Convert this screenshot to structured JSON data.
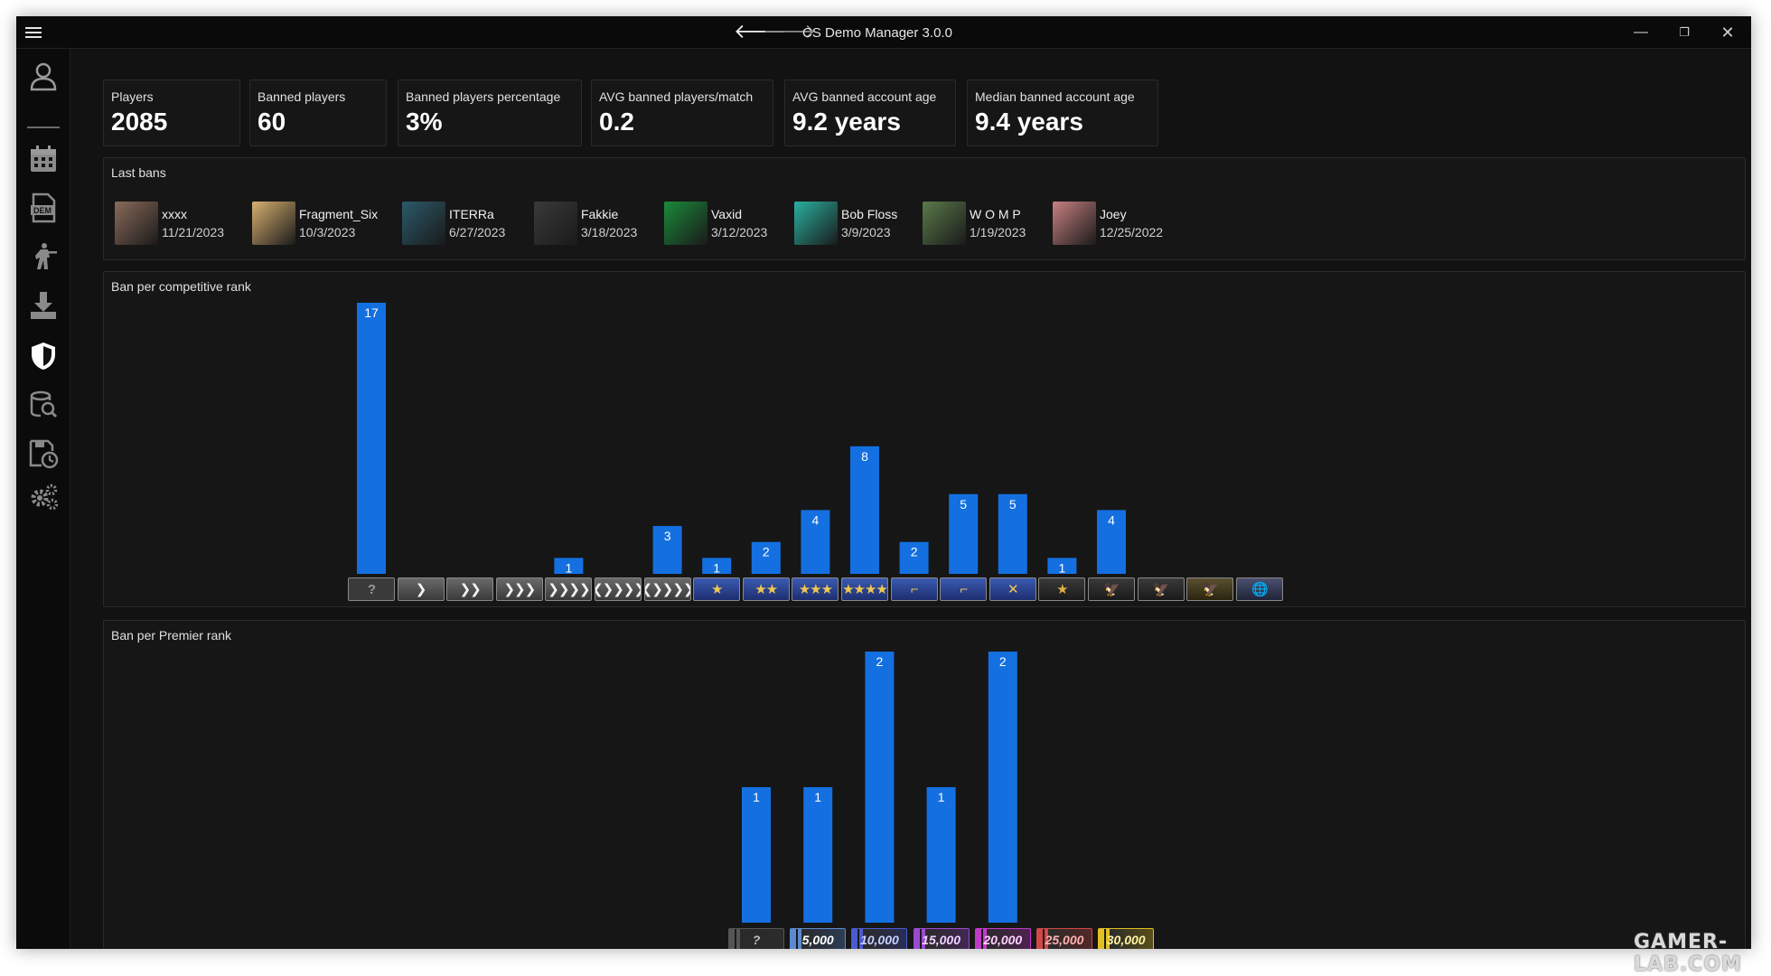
{
  "window": {
    "title": "CS Demo Manager 3.0.0",
    "menu_icon": "hamburger-menu-icon",
    "controls": {
      "minimize": "—",
      "maximize": "❐",
      "close": "✕"
    }
  },
  "nav": {
    "back": "🡐",
    "forward": "🡒"
  },
  "sidebar": {
    "items": [
      {
        "icon": "user-icon"
      },
      {
        "icon": "calendar-icon"
      },
      {
        "icon": "dem-file-icon"
      },
      {
        "icon": "player-figure-icon"
      },
      {
        "icon": "download-icon"
      },
      {
        "icon": "shield-icon",
        "active": true
      },
      {
        "icon": "database-search-icon"
      },
      {
        "icon": "save-history-icon"
      },
      {
        "icon": "settings-gears-icon"
      }
    ]
  },
  "stats": [
    {
      "label": "Players",
      "value": "2085"
    },
    {
      "label": "Banned players",
      "value": "60"
    },
    {
      "label": "Banned players percentage",
      "value": "3%"
    },
    {
      "label": "AVG banned players/match",
      "value": "0.2"
    },
    {
      "label": "AVG banned account age",
      "value": "9.2 years"
    },
    {
      "label": "Median banned account age",
      "value": "9.4 years"
    }
  ],
  "last_bans": {
    "title": "Last bans",
    "items": [
      {
        "name": "xxxx",
        "date": "11/21/2023",
        "avatar_color": "#8a6a5a"
      },
      {
        "name": "Fragment_Six",
        "date": "10/3/2023",
        "avatar_color": "#d8b070"
      },
      {
        "name": "ITERRa",
        "date": "6/27/2023",
        "avatar_color": "#2b5a6a"
      },
      {
        "name": "Fakkie",
        "date": "3/18/2023",
        "avatar_color": "#3a3a3a"
      },
      {
        "name": "Vaxid",
        "date": "3/12/2023",
        "avatar_color": "#1a8a3a"
      },
      {
        "name": "Bob Floss",
        "date": "3/9/2023",
        "avatar_color": "#2ab0a0"
      },
      {
        "name": "W O M P",
        "date": "1/19/2023",
        "avatar_color": "#5a7a4a"
      },
      {
        "name": "Joey",
        "date": "12/25/2022",
        "avatar_color": "#c88080"
      }
    ]
  },
  "competitive_chart": {
    "title": "Ban per competitive rank",
    "chart_data": {
      "type": "bar",
      "categories": [
        "?",
        "Silver I",
        "Silver II",
        "Silver III",
        "Silver IV",
        "Silver Elite",
        "Silver Elite Master",
        "Gold Nova I",
        "Gold Nova II",
        "Gold Nova III",
        "Gold Nova Master",
        "Master Guardian I",
        "Master Guardian II",
        "Master Guardian Elite",
        "Distinguished Master Guardian",
        "Legendary Eagle",
        "Legendary Eagle Master",
        "Supreme Master First Class",
        "Global Elite"
      ],
      "values": [
        17,
        0,
        0,
        0,
        1,
        0,
        3,
        1,
        2,
        4,
        8,
        2,
        5,
        5,
        1,
        4,
        0,
        0,
        0
      ],
      "badge_glyphs": [
        "?",
        "❯",
        "❯❯",
        "❯❯❯",
        "❯❯❯❯",
        "❮❯❯❯❯",
        "❮❯❯❯❯",
        "★",
        "★★",
        "★★★",
        "★★★★",
        "⌐",
        "⌐",
        "✕",
        "★",
        "🦅",
        "🦅",
        "🦅",
        "🌐"
      ],
      "badge_styles": [
        "unranked",
        "silver",
        "silver",
        "silver",
        "silver",
        "silver",
        "silver",
        "nova",
        "nova",
        "nova",
        "nova",
        "mg",
        "mg",
        "mg",
        "dmg",
        "eagle",
        "eagle",
        "smfc",
        "ge"
      ]
    }
  },
  "premier_chart": {
    "title": "Ban per Premier rank",
    "chart_data": {
      "type": "bar",
      "categories": [
        "?",
        "5,000",
        "10,000",
        "15,000",
        "20,000",
        "25,000",
        "30,000"
      ],
      "values": [
        1,
        1,
        2,
        1,
        2,
        0,
        0
      ],
      "badge_colors": [
        "#555555",
        "#5a8ad0",
        "#4a5ad0",
        "#9a4ad0",
        "#c03ac8",
        "#d04848",
        "#e0c020"
      ],
      "badge_text_colors": [
        "#bbbbbb",
        "#ffffff",
        "#c8d0ff",
        "#f0d0ff",
        "#ffd0ff",
        "#ffb0b0",
        "#fff2a0"
      ]
    }
  },
  "watermark": "GAMER-LAB.COM"
}
